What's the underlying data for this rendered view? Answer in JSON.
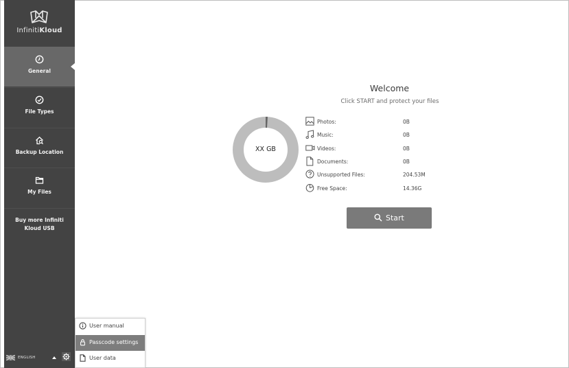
{
  "app": {
    "name_prefix": "Infiniti",
    "name_bold": "Kloud"
  },
  "sidebar": {
    "items": [
      {
        "label": "General",
        "icon": "clock-icon",
        "active": true
      },
      {
        "label": "File Types",
        "icon": "check-circle-icon",
        "active": false
      },
      {
        "label": "Backup Location",
        "icon": "home-search-icon",
        "active": false
      },
      {
        "label": "My Files",
        "icon": "folder-icon",
        "active": false
      }
    ],
    "buy_more": "Buy more Infiniti Kloud USB"
  },
  "language": {
    "label": "ENGLISH",
    "flag": "uk-flag-icon"
  },
  "menu": {
    "items": [
      {
        "label": "User manual",
        "icon": "info-icon"
      },
      {
        "label": "Passcode settings",
        "icon": "lock-icon"
      },
      {
        "label": "User data",
        "icon": "document-icon"
      }
    ]
  },
  "main": {
    "title": "Welcome",
    "subtitle": "Click START and protect your files",
    "donut_label": "XX GB",
    "stats": [
      {
        "label": "Photos:",
        "value": "0B",
        "icon": "image-icon"
      },
      {
        "label": "Music:",
        "value": "0B",
        "icon": "music-note-icon"
      },
      {
        "label": "Videos:",
        "value": "0B",
        "icon": "video-camera-icon"
      },
      {
        "label": "Documents:",
        "value": "0B",
        "icon": "document-icon"
      },
      {
        "label": "Unsupported Files:",
        "value": "204.53M",
        "icon": "question-circle-icon"
      },
      {
        "label": "Free Space:",
        "value": "14.36G",
        "icon": "pie-icon"
      }
    ],
    "start_label": "Start"
  },
  "colors": {
    "sidebar_bg": "#434343",
    "active_bg": "#686868",
    "donut_free": "#bdbdbd",
    "donut_used": "#666666",
    "button_bg": "#7a7a7a"
  }
}
